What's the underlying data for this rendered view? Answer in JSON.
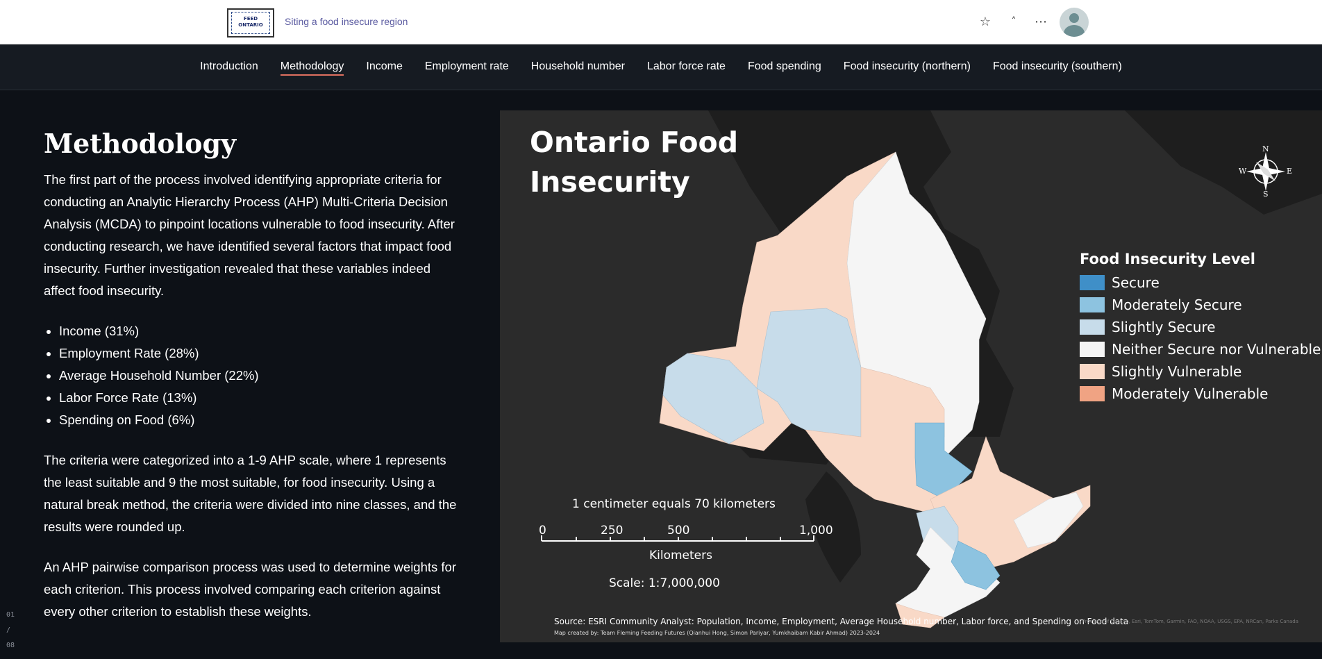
{
  "header": {
    "logo_text": "FEED ONTARIO",
    "site_title": "Siting a food insecure region",
    "icons": [
      "star-icon",
      "caret-up-icon",
      "more-icon",
      "avatar"
    ]
  },
  "nav": {
    "items": [
      {
        "label": "Introduction"
      },
      {
        "label": "Methodology"
      },
      {
        "label": "Income"
      },
      {
        "label": "Employment rate"
      },
      {
        "label": "Household number"
      },
      {
        "label": "Labor force rate"
      },
      {
        "label": "Food spending"
      },
      {
        "label": "Food insecurity (northern)"
      },
      {
        "label": "Food insecurity (southern)"
      }
    ],
    "active": "Methodology"
  },
  "content": {
    "heading": "Methodology",
    "para1": "The first part of the process involved identifying appropriate criteria for conducting an Analytic Hierarchy Process (AHP) Multi-Criteria Decision Analysis (MCDA) to pinpoint locations vulnerable to food insecurity. After conducting research, we have identified several factors that impact food insecurity. Further investigation revealed that these variables indeed affect food insecurity.",
    "criteria": [
      "Income (31%)",
      "Employment Rate (28%)",
      "Average Household Number (22%)",
      "Labor Force Rate (13%)",
      "Spending on Food (6%)"
    ],
    "para2": "The criteria were categorized into a 1-9 AHP scale, where 1 represents the least suitable and 9 the most suitable, for food insecurity. Using a natural break method, the criteria were divided into nine classes, and the results were rounded up.",
    "para3": "An AHP pairwise comparison process was used to determine weights for each criterion. This process involved comparing each criterion against every other criterion to establish these weights."
  },
  "pager": {
    "current": "01",
    "sep": "/",
    "total": "08"
  },
  "map": {
    "title_line1": "Ontario Food",
    "title_line2": "Insecurity",
    "compass": {
      "n": "N",
      "s": "S",
      "e": "E",
      "w": "W"
    },
    "legend_title": "Food Insecurity Level",
    "legend": [
      {
        "label": "Secure",
        "color": "#3f8fc8"
      },
      {
        "label": "Moderately Secure",
        "color": "#8dc3e0"
      },
      {
        "label": "Slightly Secure",
        "color": "#c7dcea"
      },
      {
        "label": "Neither Secure nor Vulnerable",
        "color": "#f5f5f5"
      },
      {
        "label": "Slightly Vulnerable",
        "color": "#f9d9c7"
      },
      {
        "label": "Moderately Vulnerable",
        "color": "#f0a383"
      }
    ],
    "scale_caption": "1 centimeter equals 70 kilometers",
    "scale_ticks": [
      "0",
      "250",
      "500",
      "1,000"
    ],
    "scale_unit": "Kilometers",
    "scale_ratio": "Scale: 1:7,000,000",
    "source": "Source: ESRI Community Analyst: Population, Income, Employment, Average Household number, Labor force, and Spending on Food data",
    "credit": "Map created by: Team Fleming Feeding Futures (Qianhui Hong, Simon Pariyar, Yumkhaibam Kabir Ahmad) 2023-2024",
    "attribution": "Province of Ontario, Esri, TomTom, Garmin, FAO, NOAA, USGS, EPA, NRCan, Parks Canada"
  }
}
